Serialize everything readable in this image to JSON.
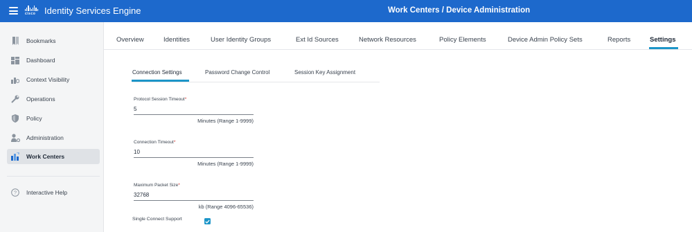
{
  "header": {
    "brand_text": "cisco",
    "app_title": "Identity Services Engine",
    "page_title": "Work Centers / Device Administration",
    "bg_color": "#1d69cc"
  },
  "sidebar": {
    "items": [
      {
        "label": "Bookmarks",
        "icon": "bookmark-icon"
      },
      {
        "label": "Dashboard",
        "icon": "dashboard-icon"
      },
      {
        "label": "Context Visibility",
        "icon": "context-visibility-icon"
      },
      {
        "label": "Operations",
        "icon": "wrench-icon"
      },
      {
        "label": "Policy",
        "icon": "shield-icon"
      },
      {
        "label": "Administration",
        "icon": "admin-user-gear-icon"
      },
      {
        "label": "Work Centers",
        "icon": "work-centers-icon",
        "active": true
      },
      {
        "label": "Interactive Help",
        "icon": "help-circle-icon"
      }
    ]
  },
  "tabs": {
    "items": [
      "Overview",
      "Identities",
      "User Identity Groups",
      "Ext Id Sources",
      "Network Resources",
      "Policy Elements",
      "Device Admin Policy Sets",
      "Reports",
      "Settings"
    ],
    "active": "Settings",
    "accent_color": "#1c95c8"
  },
  "subtabs": {
    "items": [
      "Connection Settings",
      "Password Change Control",
      "Session Key Assignment"
    ],
    "active": "Connection Settings"
  },
  "form": {
    "protocol_session_timeout": {
      "label": "Protocol Session Timeout",
      "required_mark": "*",
      "value": "5",
      "hint": "Minutes (Range 1-9999)"
    },
    "connection_timeout": {
      "label": "Connection Timeout",
      "required_mark": "*",
      "value": "10",
      "hint": "Minutes (Range 1-9999)"
    },
    "maximum_packet_size": {
      "label": "Maximum Packet Size",
      "required_mark": "*",
      "value": "32768",
      "hint": "kb (Range 4096-65536)"
    },
    "single_connect_support": {
      "label": "Single Connect Support",
      "checked": true
    }
  }
}
